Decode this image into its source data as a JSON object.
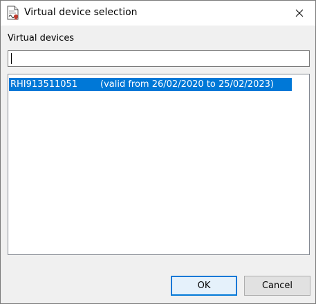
{
  "window": {
    "title": "Virtual device selection"
  },
  "form": {
    "devices_label": "Virtual devices",
    "filter_value": ""
  },
  "devices": [
    {
      "id": "RHI913511051",
      "validity": "(valid from 26/02/2020 to 25/02/2023)",
      "selected": true
    }
  ],
  "buttons": {
    "ok_label": "OK",
    "cancel_label": "Cancel"
  },
  "colors": {
    "selection": "#0078d7",
    "selection_text": "#ffffff",
    "dialog_background": "#f0f0f0",
    "default_button_border": "#0078d7"
  }
}
